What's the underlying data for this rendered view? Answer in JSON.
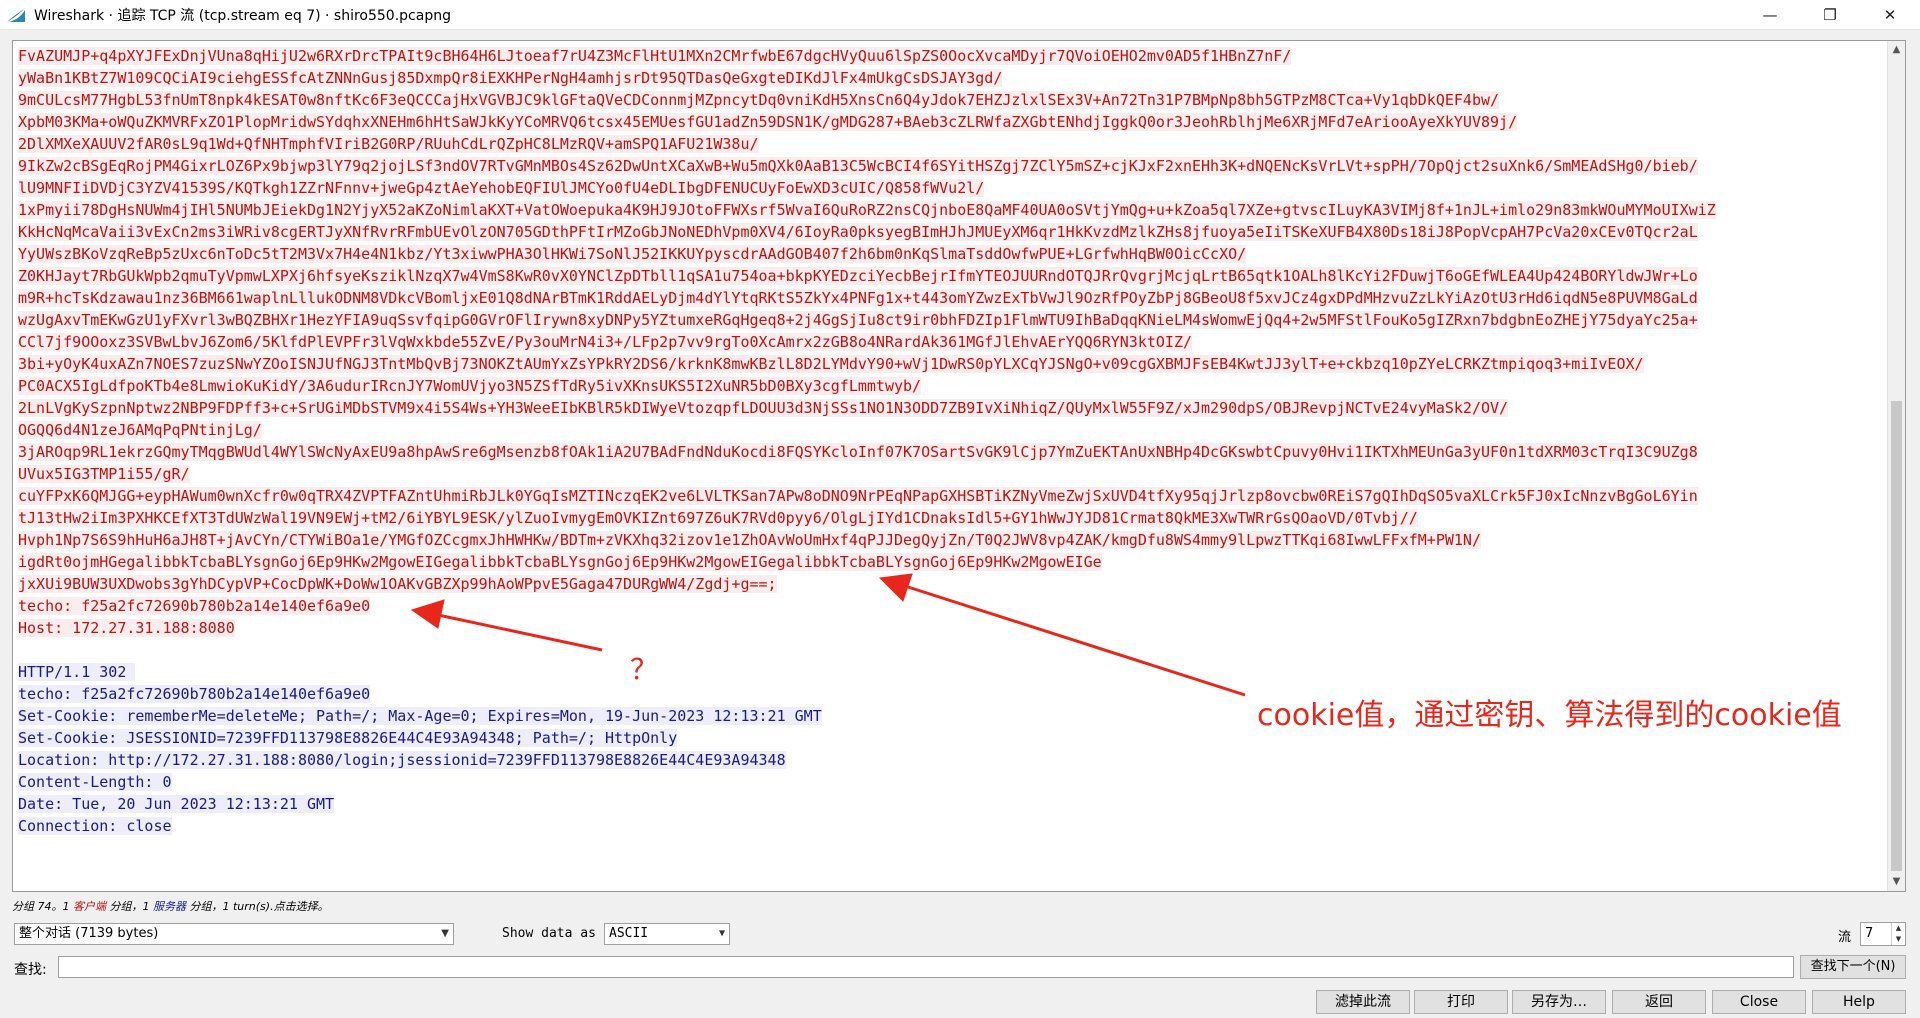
{
  "window": {
    "title": "Wireshark · 追踪 TCP 流 (tcp.stream eq 7) · shiro550.pcapng",
    "icon": "wireshark-fin-icon"
  },
  "stream": {
    "client_lines": [
      "FvAZUMJP+q4pXYJFExDnjVUna8qHijU2w6RXrDrcTPAIt9cBH64H6LJtoeaf7rU4Z3McFlHtU1MXn2CMrfwbE67dgcHVyQuu6lSpZS0OocXvcaMDyjr7QVoiOEHO2mv0AD5f1HBnZ7nF/",
      "yWaBn1KBtZ7W109CQCiAI9ciehgESSfcAtZNNnGusj85DxmpQr8iEXKHPerNgH4amhjsrDt95QTDasQeGxgteDIKdJlFx4mUkgCsDSJAY3gd/",
      "9mCULcsM77HgbL53fnUmT8npk4kESAT0w8nftKc6F3eQCCCajHxVGVBJC9klGFtaQVeCDConnmjMZpncytDq0vniKdH5XnsCn6Q4yJdok7EHZJzlxlSEx3V+An72Tn31P7BMpNp8bh5GTPzM8CTca+Vy1qbDkQEF4bw/",
      "XpbM03KMa+oWQuZKMVRFxZO1PlopMridwSYdqhxXNEHm6hHtSaWJkKyYCoMRVQ6tcsx45EMUesfGU1adZn59DSN1K/gMDG287+BAeb3cZLRWfaZXGbtENhdjIggkQ0or3JeohRblhjMe6XRjMFd7eAriooAyeXkYUV89j/",
      "2DlXMXeXAUUV2fAR0sL9q1Wd+QfNHTmphfVIriB2G0RP/RUuhCdLrQZpHC8LMzRQV+amSPQ1AFU21W38u/",
      "9IkZw2cBSgEqRojPM4GixrLOZ6Px9bjwp3lY79q2jojLSf3ndOV7RTvGMnMBOs4Sz62DwUntXCaXwB+Wu5mQXk0AaB13C5WcBCI4f6SYitHSZgj7ZClY5mSZ+cjKJxF2xnEHh3K+dNQENcKsVrLVt+spPH/7OpQjct2suXnk6/SmMEAdSHg0/bieb/",
      "lU9MNFIiDVDjC3YZV41539S/KQTkgh1ZZrNFnnv+jweGp4ztAeYehobEQFIUlJMCYo0fU4eDLIbgDFENUCUyFoEwXD3cUIC/Q858fWVu2l/",
      "1xPmyii78DgHsNUWm4jIHl5NUMbJEiekDg1N2YjyX52aKZoNimlaKXT+VatOWoepuka4K9HJ9JOtoFFWXsrf5WvaI6QuRoRZ2nsCQjnboE8QaMF40UA0oSVtjYmQg+u+kZoa5ql7XZe+gtvscILuyKA3VIMj8f+1nJL+imlo29n83mkWOuMYMoUIXwiZ",
      "KkHcNqMcaVaii3vExCn2ms3iWRiv8cgERTJyXNfRvrRFmbUEvOlzON705GDthPFtIrMZoGbJNoNEDhVpm0XV4/6IoyRa0pksyegBImHJhJMUEyXM6qr1HkKvzdMzlkZHs8jfuoya5eIiTSKeXUFB4X80Ds18iJ8PopVcpAH7PcVa20xCEv0TQcr2aL",
      "YyUWszBKoVzqReBp5zUxc6nToDc5tT2M3Vx7H4e4N1kbz/Yt3xiwwPHA3OlHKWi7SoNlJ52IKKUYpyscdrAAdGOB407f2h6bm0nKqSlmaTsddOwfwPUE+LGrfwhHqBW0OicCcXO/",
      "Z0KHJayt7RbGUkWpb2qmuTyVpmwLXPXj6hfsyeKsziklNzqX7w4VmS8KwR0vX0YNClZpDTbll1qSA1u754oa+bkpKYEDzciYecbBejrIfmYTEOJUURndOTQJRrQvgrjMcjqLrtB65qtk1OALh8lKcYi2FDuwjT6oGEfWLEA4Up424BORYldwJWr+Lo",
      "m9R+hcTsKdzawau1nz36BM661waplnLllukODNM8VDkcVBomljxE01Q8dNArBTmK1RddAELyDjm4dYlYtqRKtS5ZkYx4PNFg1x+t443omYZwzExTbVwJl9OzRfPOyZbPj8GBeoU8f5xvJCz4gxDPdMHzvuZzLkYiAzOtU3rHd6iqdN5e8PUVM8GaLd",
      "wzUgAxvTmEKwGzU1yFXvrl3wBQZBHXr1HezYFIA9uqSsvfqipG0GVrOFlIrywn8xyDNPy5YZtumxeRGqHgeq8+2j4GgSjIu8ct9ir0bhFDZIp1FlmWTU9IhBaDqqKNieLM4sWomwEjQq4+2w5MFStlFouKo5gIZRxn7bdgbnEoZHEjY75dyaYc25a+",
      "CCl7jf9OOoxz3SVBwLbvJ6Zom6/5KlfdPlEVPFr3lVqWxkbde55ZvE/Py3ouMrN4i3+/LFp2p7vv9rgTo0XcAmrx2zGB8o4NRardAk361MGfJlEhvAErYQQ6RYN3ktOIZ/",
      "3bi+yOyK4uxAZn7NOES7zuzSNwYZOoISNJUfNGJ3TntMbQvBj73NOKZtAUmYxZsYPkRY2DS6/krknK8mwKBzlL8D2LYMdvY90+wVj1DwRS0pYLXCqYJSNgO+v09cgGXBMJFsEB4KwtJJ3ylT+e+ckbzq10pZYeLCRKZtmpiqoq3+miIvEOX/",
      "PC0ACX5IgLdfpoKTb4e8LmwioKuKidY/3A6udurIRcnJY7WomUVjyo3N5ZSfTdRy5ivXKnsUKS5I2XuNR5bD0BXy3cgfLmmtwyb/",
      "2LnLVgKySzpnNptwz2NBP9FDPff3+c+SrUGiMDbSTVM9x4i5S4Ws+YH3WeeEIbKBlR5kDIWyeVtozqpfLDOUU3d3NjSSs1NO1N3ODD7ZB9IvXiNhiqZ/QUyMxlW55F9Z/xJm290dpS/OBJRevpjNCTvE24vyMaSk2/OV/",
      "OGQQ6d4N1zeJ6AMqPqPNtinjLg/",
      "3jAROqp9RL1ekrzGQmyTMqgBWUdl4WYlSWcNyAxEU9a8hpAwSre6gMsenzb8fOAk1iA2U7BAdFndNduKocdi8FQSYKcloInf07K7OSartSvGK9lCjp7YmZuEKTAnUxNBHp4DcGKswbtCpuvy0Hvi1IKTXhMEUnGa3yUF0n1tdXRM03cTrqI3C9UZg8",
      "UVux5IG3TMP1i55/gR/",
      "cuYFPxK6QMJGG+eypHAWum0wnXcfr0w0qTRX4ZVPTFAZntUhmiRbJLk0YGqIsMZTINczqEK2ve6LVLTKSan7APw8oDNO9NrPEqNPapGXHSBTiKZNyVmeZwjSxUVD4tfXy95qjJrlzp8ovcbw0REiS7gQIhDqSO5vaXLCrk5FJ0xIcNnzvBgGoL6Yin",
      "tJ13tHw2iIm3PXHKCEfXT3TdUWzWal19VN9EWj+tM2/6iYBYL9ESK/ylZuoIvmygEmOVKIZnt697Z6uK7RVd0pyy6/OlgLjIYd1CDnaksIdl5+GY1hWwJYJD81Crmat8QkME3XwTWRrGsQOaoVD/0Tvbj//",
      "Hvph1Np7S6S9hHuH6aJH8T+jAvCYn/CTYWiBOa1e/YMGfOZCcgmxJhHWHKw/BDTm+zVKXhq32izov1e1ZhOAvWoUmHxf4qPJJDegQyjZn/T0Q2JWV8vp4ZAK/kmgDfu8WS4mmy9lLpwzTTKqi68IwwLFFxfM+PW1N/",
      "igdRt0ojmHGegalibbkTcbaBLYsgnGoj6Ep9HKw2MgowEIGegalibbkTcbaBLYsgnGoj6Ep9HKw2MgowEIGegalibbkTcbaBLYsgnGoj6Ep9HKw2MgowEIGe",
      "jxXUi9BUW3UXDwobs3gYhDCypVP+CocDpWK+DoWw1OAKvGBZXp99hAoWPpvE5Gaga47DURgWW4/Zgdj+g==;",
      "techo: f25a2fc72690b780b2a14e140ef6a9e0",
      "Host: 172.27.31.188:8080"
    ],
    "server_lines": [
      "HTTP/1.1 302 ",
      "techo: f25a2fc72690b780b2a14e140ef6a9e0",
      "Set-Cookie: rememberMe=deleteMe; Path=/; Max-Age=0; Expires=Mon, 19-Jun-2023 12:13:21 GMT",
      "Set-Cookie: JSESSIONID=7239FFD113798E8826E44C4E93A94348; Path=/; HttpOnly",
      "Location: http://172.27.31.188:8080/login;jsessionid=7239FFD113798E8826E44C4E93A94348",
      "Content-Length: 0",
      "Date: Tue, 20 Jun 2023 12:13:21 GMT",
      "Connection: close"
    ]
  },
  "annotations": {
    "question_mark": "？",
    "cookie_note": "cookie值，通过密钥、算法得到的cookie值",
    "color": "#e8261c"
  },
  "status": {
    "part1": "分组 74。1 ",
    "client_word": "客户端",
    "part2": " 分组，1 ",
    "server_word": "服务器",
    "part3": " 分组，1 turn(s).点击选择。"
  },
  "controls": {
    "conversation_select": "整个对话 (7139 bytes)",
    "show_data_label": "Show data as",
    "show_data_value": "ASCII",
    "stream_label": "流",
    "stream_value": "7",
    "find_label": "查找:",
    "find_value": "",
    "find_next_button": "查找下一个(N)"
  },
  "buttons": {
    "filter_out": "滤掉此流",
    "print": "打印",
    "save_as": "另存为…",
    "back": "返回",
    "close": "Close",
    "help": "Help"
  },
  "colors": {
    "client_text": "#b81414",
    "client_bg": "#fbeded",
    "server_text": "#1a1a8c",
    "server_bg": "#ededfb"
  }
}
